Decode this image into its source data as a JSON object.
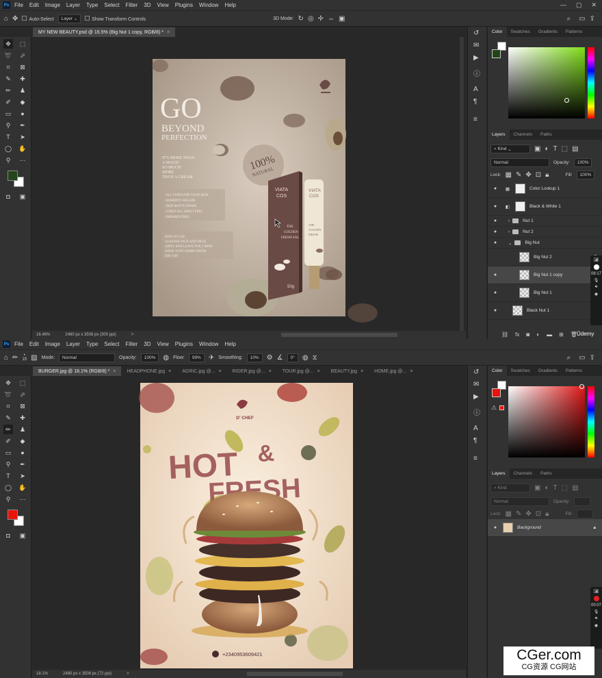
{
  "menu": [
    "File",
    "Edit",
    "Image",
    "Layer",
    "Type",
    "Select",
    "Filter",
    "3D",
    "View",
    "Plugins",
    "Window",
    "Help"
  ],
  "ps_logo": "Ps",
  "window_controls": [
    "—",
    "▢",
    "✕"
  ],
  "top": {
    "options": {
      "auto_select": "Auto-Select",
      "layer_dropdown": "Layer",
      "show_transform": "Show Transform Controls",
      "mode3d": "3D Mode:"
    },
    "tab": {
      "label": "MY NEW BEAUTY.psd @ 16.5% (Big Nut 1 copy, RGB/8) *",
      "close": "×"
    },
    "status": {
      "zoom": "16.46%",
      "size": "2480 px x 3508 px (300 ppi)",
      "arrow": ">"
    },
    "color_panel": {
      "tabs": [
        "Color",
        "Swatches",
        "Gradients",
        "Patterns"
      ],
      "fg": "#24441a",
      "hue": "#7fdc18"
    },
    "layers_panel": {
      "tabs": [
        "Layers",
        "Channels",
        "Paths"
      ],
      "filter_kind": "Kind",
      "blend": "Normal",
      "opacity_label": "Opacity:",
      "opacity": "100%",
      "lock_label": "Lock:",
      "fill_label": "Fill:",
      "fill": "100%",
      "layers": [
        {
          "name": "Color Lookup 1",
          "kind": "adjust"
        },
        {
          "name": "Black & White 1",
          "kind": "adjust"
        },
        {
          "name": "Nut 1",
          "kind": "group"
        },
        {
          "name": "Nut 2",
          "kind": "group"
        },
        {
          "name": "Big Nut",
          "kind": "group-open"
        },
        {
          "name": "Big Nut 2",
          "kind": "smart"
        },
        {
          "name": "Big Nut 1 copy",
          "kind": "smart",
          "selected": true
        },
        {
          "name": "Big Nut 1",
          "kind": "smart"
        },
        {
          "name": "Black Nut 1",
          "kind": "smart"
        }
      ]
    },
    "rec_time": "08:17",
    "watermark": "Üdemy"
  },
  "bottom": {
    "options": {
      "mode_label": "Mode:",
      "mode": "Normal",
      "opacity_label": "Opacity:",
      "opacity": "100%",
      "flow_label": "Flow:",
      "flow": "99%",
      "smoothing_label": "Smoothing:",
      "smoothing": "10%",
      "angle": "0°",
      "brush_size": "15"
    },
    "tabs": [
      {
        "label": "BURGER.jpg @ 18.1% (RGB/8) *",
        "active": true
      },
      {
        "label": "HEADPHONE.jpg"
      },
      {
        "label": "AGRIC.jpg @..."
      },
      {
        "label": "RIDER.jpg @..."
      },
      {
        "label": "TOUR.jpg @..."
      },
      {
        "label": "BEAUTY.jpg"
      },
      {
        "label": "HOME.jpg @..."
      }
    ],
    "status": {
      "zoom": "18.1%",
      "size": "2480 px x 3508 px (72 ppi)",
      "arrow": ">"
    },
    "color_panel": {
      "tabs": [
        "Color",
        "Swatches",
        "Gradients",
        "Patterns"
      ],
      "fg": "#e8140c",
      "hue": "#e01818"
    },
    "layers_panel": {
      "tabs": [
        "Layers",
        "Channels",
        "Paths"
      ],
      "filter_kind": "Kind",
      "blend": "Normal",
      "opacity_label": "Opacity:",
      "lock_label": "Lock:",
      "fill_label": "Fill:",
      "layers": [
        {
          "name": "Background"
        }
      ]
    },
    "rec_time": "00:07"
  },
  "poster1": {
    "go": "GO",
    "beyond": "BEYOND",
    "perfection": "PERFECTION",
    "tagline": [
      "IT'S MORE THAN",
      "A MAGIC",
      "SO MUCH",
      "MORE",
      "THAN A CREAM"
    ],
    "features": [
      "ALL TYPES FOR YOUR SKIN",
      "HUMIDITY REGAIN",
      "SKIN MATTE FINISH",
      "COOLS ALL SKIN TYPES",
      "PARABEN FREE"
    ],
    "howto": [
      "HOW TO USE:",
      "CLEANSE FACE AND NECK",
      "APPLY AND LEAVE FOR 2 MINS",
      "RINSE WITH WARM WATER",
      "DRY OFF"
    ],
    "badge_big": "100%",
    "badge_small": "NATURAL",
    "box_brand": [
      "VIATA",
      "COS"
    ],
    "box_sub": [
      "THE",
      "GOLDEN",
      "FRESH SAL"
    ],
    "box_weight": "50g",
    "tube_brand": [
      "VIATA",
      "COS"
    ],
    "tube_sub": [
      "THE",
      "GOLDEN",
      "FRESH"
    ]
  },
  "poster2": {
    "logo": "D' CHEF",
    "hot": "HOT",
    "amp": "&",
    "fresh": "FRESH",
    "phone": "+2340953609421"
  },
  "watermark": {
    "main": "CGer.com",
    "sub": "CG资源 CG网站"
  }
}
